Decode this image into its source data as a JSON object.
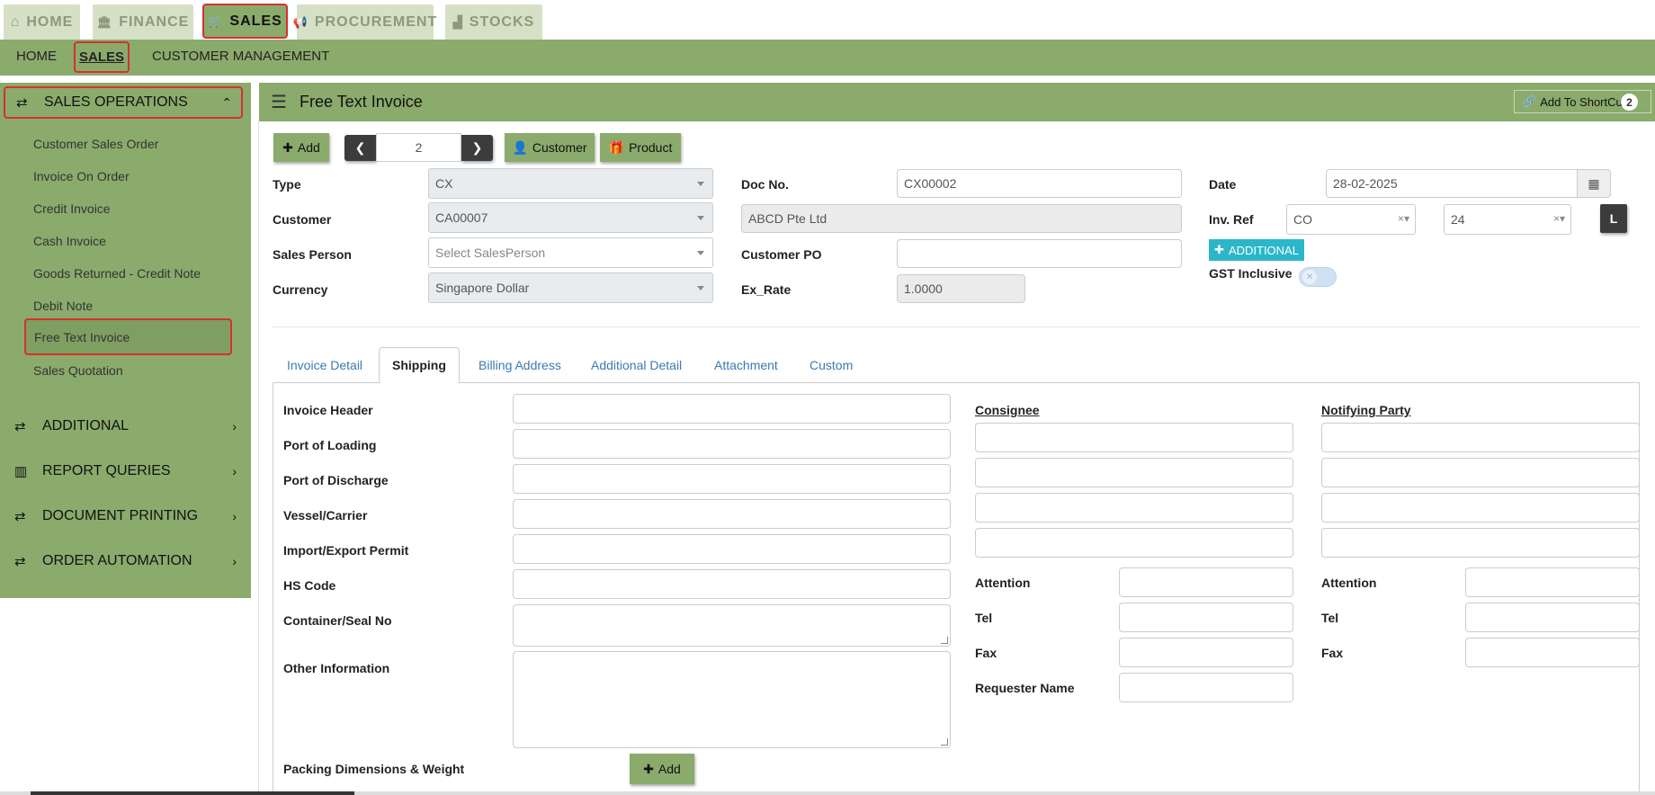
{
  "top_tabs": [
    {
      "icon": "⌂",
      "label": "HOME"
    },
    {
      "icon": "🏛",
      "label": "FINANCE"
    },
    {
      "icon": "🛒",
      "label": "SALES"
    },
    {
      "icon": "📢",
      "label": "PROCUREMENT"
    },
    {
      "icon": "▟",
      "label": "STOCKS"
    }
  ],
  "subnav": [
    "HOME",
    "SALES",
    "CUSTOMER MANAGEMENT"
  ],
  "sidebar": {
    "sales_ops": "SALES OPERATIONS",
    "items": [
      "Customer Sales Order",
      "Invoice On Order",
      "Credit Invoice",
      "Cash Invoice",
      "Goods Returned - Credit Note",
      "Debit Note",
      "Free Text Invoice",
      "Sales Quotation"
    ],
    "sections": [
      "ADDITIONAL",
      "REPORT QUERIES",
      "DOCUMENT PRINTING",
      "ORDER AUTOMATION"
    ]
  },
  "header": {
    "title": "Free Text Invoice",
    "shortcut": "Add To ShortCut",
    "badge": "2"
  },
  "toolbar": {
    "add": "Add",
    "page": "2",
    "customer": "Customer",
    "product": "Product"
  },
  "form": {
    "type_label": "Type",
    "type_value": "CX",
    "customer_label": "Customer",
    "customer_value": "CA00007",
    "salesperson_label": "Sales Person",
    "salesperson_placeholder": "Select SalesPerson",
    "currency_label": "Currency",
    "currency_value": "Singapore Dollar",
    "docno_label": "Doc No.",
    "docno_value": "CX00002",
    "customer_name": "ABCD Pte Ltd",
    "custpo_label": "Customer PO",
    "exrate_label": "Ex_Rate",
    "exrate_value": "1.0000",
    "date_label": "Date",
    "date_value": "28-02-2025",
    "invref_label": "Inv. Ref",
    "invref_1": "CO",
    "invref_2": "24",
    "l_button": "L",
    "additional_button": "ADDITIONAL",
    "gst_label": "GST Inclusive"
  },
  "tabs": [
    "Invoice Detail",
    "Shipping",
    "Billing Address",
    "Additional Detail",
    "Attachment",
    "Custom"
  ],
  "shipping": {
    "fields": [
      "Invoice Header",
      "Port of Loading",
      "Port of Discharge",
      "Vessel/Carrier",
      "Import/Export Permit",
      "HS Code",
      "Container/Seal No",
      "Other Information",
      "Packing Dimensions & Weight"
    ],
    "add": "Add",
    "consignee": "Consignee",
    "notifying": "Notifying Party",
    "attention": "Attention",
    "tel": "Tel",
    "fax": "Fax",
    "requester": "Requester Name"
  }
}
